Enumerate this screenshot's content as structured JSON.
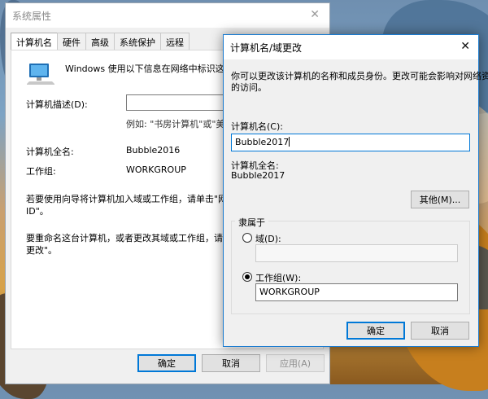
{
  "bg_window": {
    "title": "系统属性",
    "close_glyph": "✕",
    "tabs": [
      "计算机名",
      "硬件",
      "高级",
      "系统保护",
      "远程"
    ],
    "intro_text": "Windows 使用以下信息在网络中标识这台计算",
    "description_label": "计算机描述(D):",
    "description_value": "",
    "example_text": "例如: \"书房计算机\"或\"美玲的",
    "full_name_label": "计算机全名:",
    "full_name_value": "Bubble2016",
    "workgroup_label": "工作组:",
    "workgroup_value": "WORKGROUP",
    "wizard_text_line1": "若要使用向导将计算机加入域或工作组，请单击\"网络",
    "wizard_text_line2": "ID\"。",
    "rename_text_line1": "要重命名这台计算机，或者更改其域或工作组，请单击\"",
    "rename_text_line2": "更改\"。",
    "ok_label": "确定",
    "cancel_label": "取消",
    "apply_label": "应用(A)"
  },
  "dialog": {
    "title": "计算机名/域更改",
    "close_glyph": "✕",
    "desc_line1": "你可以更改该计算机的名称和成员身份。更改可能会影响对网络资源",
    "desc_line2": "的访问。",
    "name_label": "计算机名(C):",
    "name_value": "Bubble2017",
    "full_name_label": "计算机全名:",
    "full_name_value": "Bubble2017",
    "more_label": "其他(M)...",
    "member_of_label": "隶属于",
    "domain_label": "域(D):",
    "domain_value": "",
    "workgroup_label": "工作组(W):",
    "workgroup_value": "WORKGROUP",
    "selected_membership": "workgroup",
    "ok_label": "确定",
    "cancel_label": "取消"
  },
  "icons": {
    "computer": "computer-icon"
  },
  "colors": {
    "accent": "#0078d7",
    "dialog_border": "#1a7bd0"
  }
}
